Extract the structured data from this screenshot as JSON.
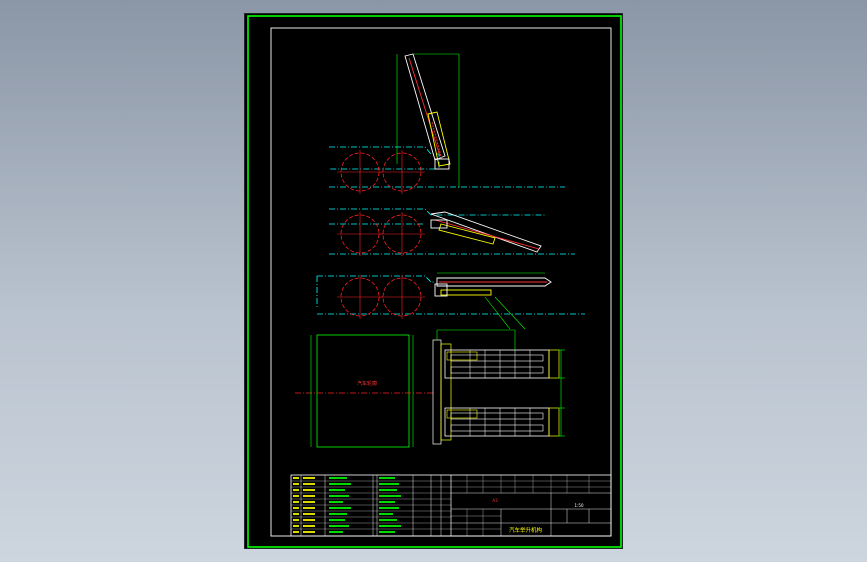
{
  "drawing": {
    "notes": {
      "vehicle_label": "汽车轮廓",
      "title_block_name": "汽车举升机构",
      "scale": "1:50",
      "material": "A3"
    },
    "colors": {
      "background": "#000000",
      "border": "#00ff00",
      "frame": "#ffffff",
      "chassis": "#00ffff",
      "center_lines": "#ff0000",
      "parts": "#ffff00",
      "boom": "#ff3030",
      "dimensions": "#00ff00"
    }
  }
}
